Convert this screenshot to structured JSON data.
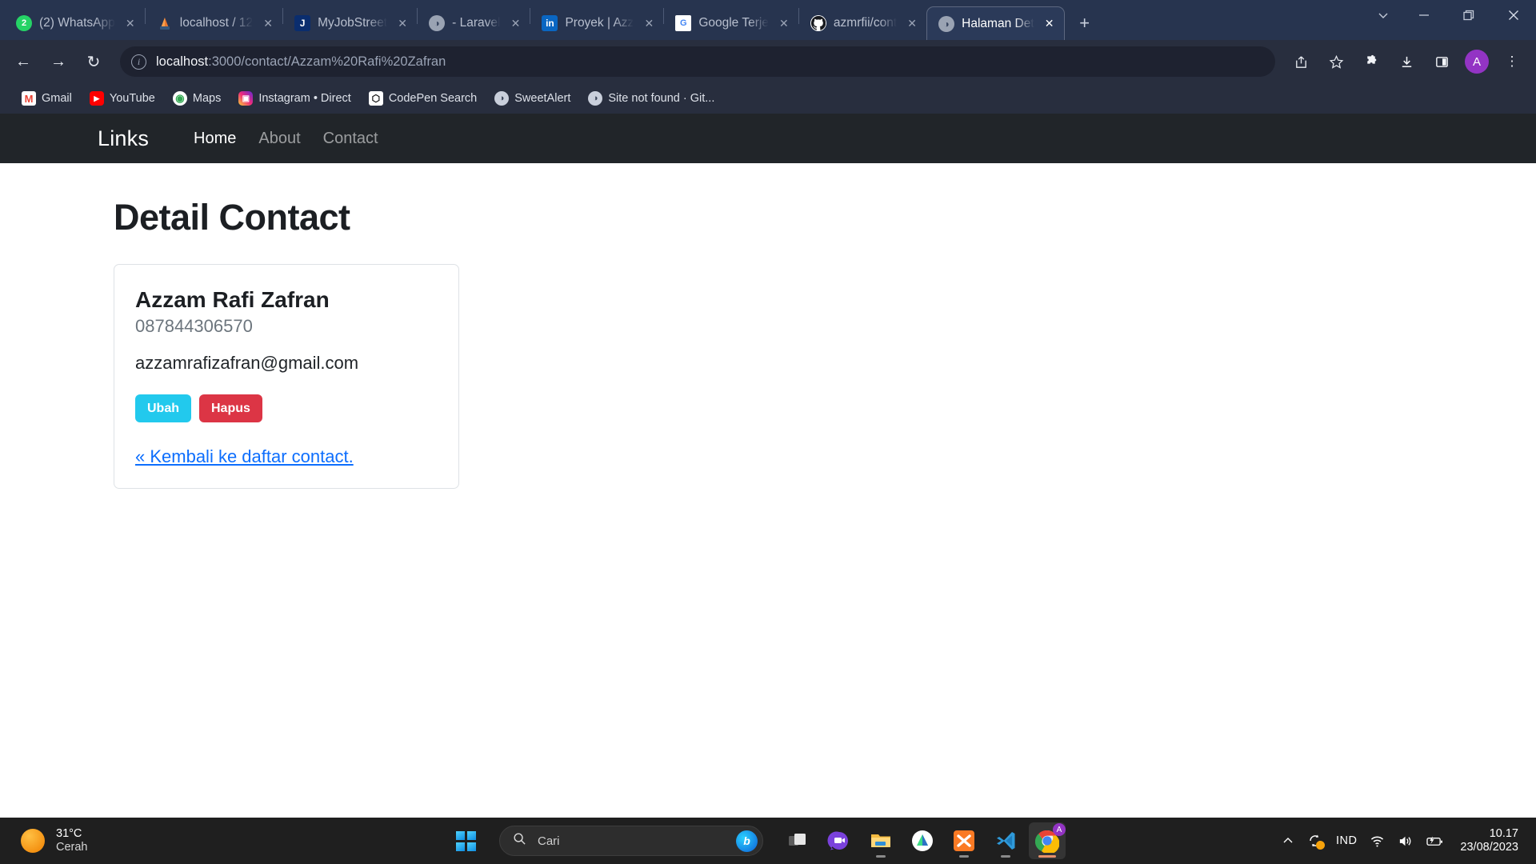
{
  "browser": {
    "tabs": [
      {
        "title": "(2) WhatsApp",
        "icon": "whatsapp-icon",
        "icon_glyph": "2",
        "active": false
      },
      {
        "title": "localhost / 12",
        "icon": "phpmyadmin-icon",
        "icon_glyph": "",
        "active": false
      },
      {
        "title": "MyJobStreet",
        "icon": "jobstreet-icon",
        "icon_glyph": "J",
        "active": false
      },
      {
        "title": "- Laravel",
        "icon": "globe-icon",
        "icon_glyph": "◑",
        "active": false
      },
      {
        "title": "Proyek | Azz",
        "icon": "linkedin-icon",
        "icon_glyph": "in",
        "active": false
      },
      {
        "title": "Google Terje",
        "icon": "google-translate-icon",
        "icon_glyph": "G",
        "active": false
      },
      {
        "title": "azmrfii/cont",
        "icon": "github-icon",
        "icon_glyph": "●",
        "active": false
      },
      {
        "title": "Halaman Det",
        "icon": "globe-icon",
        "icon_glyph": "◑",
        "active": true
      }
    ],
    "new_tab_label": "+",
    "window_controls": {
      "tab_search": "⌄",
      "minimize": "—",
      "maximize": "❐",
      "close": "✕"
    },
    "nav": {
      "back": "←",
      "forward": "→",
      "reload": "↻"
    },
    "omnibox": {
      "site_info_icon": "info-icon",
      "url_host": "localhost",
      "url_path": ":3000/contact/Azzam%20Rafi%20Zafran"
    },
    "toolbar_icons": [
      {
        "name": "share-icon",
        "glyph": "↱"
      },
      {
        "name": "bookmark-star-icon",
        "glyph": "☆"
      },
      {
        "name": "extensions-puzzle-icon",
        "glyph": "❖"
      },
      {
        "name": "downloads-icon",
        "glyph": "⬇"
      },
      {
        "name": "side-panel-icon",
        "glyph": "⬜"
      }
    ],
    "profile_initial": "A",
    "menu_icon": "⋮",
    "bookmarks": [
      {
        "label": "Gmail",
        "icon": "gmail-icon",
        "glyph": "M"
      },
      {
        "label": "YouTube",
        "icon": "youtube-icon",
        "glyph": "▶"
      },
      {
        "label": "Maps",
        "icon": "google-maps-icon",
        "glyph": "◉"
      },
      {
        "label": "Instagram • Direct",
        "icon": "instagram-icon",
        "glyph": "▣"
      },
      {
        "label": "CodePen Search",
        "icon": "codepen-icon",
        "glyph": "⬡"
      },
      {
        "label": "SweetAlert",
        "icon": "globe-icon",
        "glyph": "◑"
      },
      {
        "label": "Site not found · Git...",
        "icon": "globe-icon",
        "glyph": "◑"
      }
    ]
  },
  "site": {
    "brand": "Links",
    "nav_links": [
      {
        "label": "Home",
        "active": true
      },
      {
        "label": "About",
        "active": false
      },
      {
        "label": "Contact",
        "active": false
      }
    ],
    "page_title": "Detail Contact",
    "contact": {
      "name": "Azzam Rafi Zafran",
      "phone": "087844306570",
      "email": "azzamrafizafran@gmail.com"
    },
    "buttons": {
      "edit": "Ubah",
      "delete": "Hapus",
      "edit_color": "#22c9ed",
      "delete_color": "#dc3545"
    },
    "back_link": "« Kembali ke daftar contact.",
    "link_color": "#0d6efd"
  },
  "taskbar": {
    "weather": {
      "temperature": "31°C",
      "description": "Cerah"
    },
    "start_label": "start-button",
    "search": {
      "placeholder": "Cari",
      "assistant_glyph": "b"
    },
    "apps": [
      {
        "name": "task-view-icon",
        "running": false,
        "active": false
      },
      {
        "name": "chat-teams-icon",
        "running": false,
        "active": false
      },
      {
        "name": "file-explorer-icon",
        "running": true,
        "active": false
      },
      {
        "name": "android-studio-icon",
        "running": false,
        "active": false
      },
      {
        "name": "xampp-icon",
        "running": true,
        "active": false
      },
      {
        "name": "vscode-icon",
        "running": true,
        "active": false
      },
      {
        "name": "chrome-icon",
        "running": true,
        "active": true
      }
    ],
    "tray": {
      "overflow_glyph": "⌃",
      "sync_glyph": "⟳",
      "language": "IND",
      "wifi_glyph": "◠",
      "volume_glyph": "🔊",
      "battery_glyph": "▭"
    },
    "clock": {
      "time": "10.17",
      "date": "23/08/2023"
    }
  }
}
